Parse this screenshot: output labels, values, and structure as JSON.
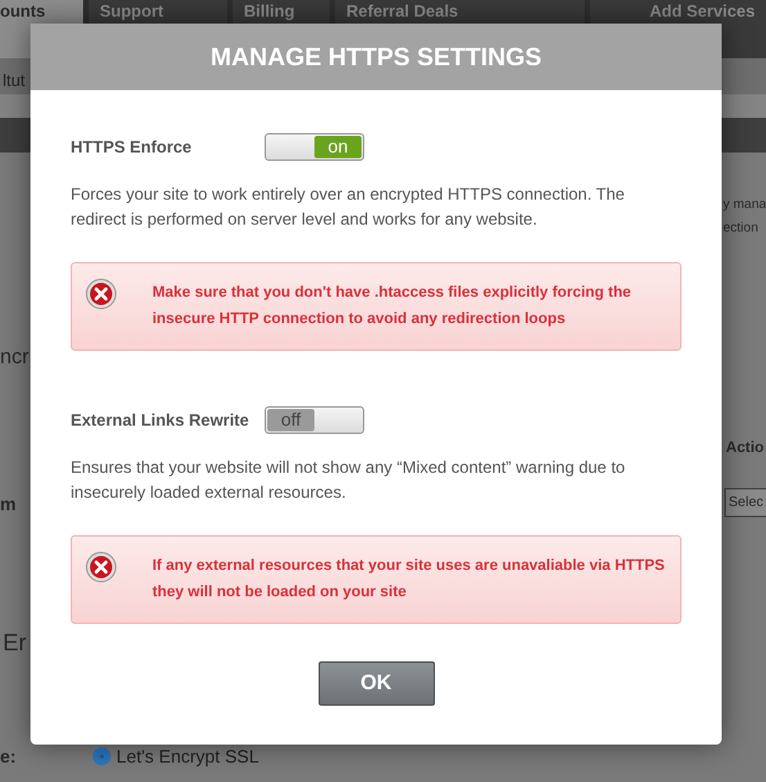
{
  "background": {
    "tabs": [
      {
        "label": "ounts",
        "selected": true
      },
      {
        "label": "Support",
        "selected": false
      },
      {
        "label": "Billing",
        "selected": false
      },
      {
        "label": "Referral Deals",
        "selected": false
      },
      {
        "label": "Add Services",
        "selected": false
      }
    ],
    "breadcrumb": "ltut",
    "description_lines": [
      "y mana",
      "ection"
    ],
    "section_heading": "ncr",
    "table": {
      "header": "Actio",
      "cell": "m",
      "select": "Selec"
    },
    "section_heading_2": "Er",
    "field_label": "e:",
    "radio": {
      "label": "Let's Encrypt SSL",
      "selected": true
    }
  },
  "modal": {
    "title": "MANAGE HTTPS SETTINGS",
    "settings": [
      {
        "label": "HTTPS Enforce",
        "on": true,
        "toggle_text": "on",
        "description": "Forces your site to work entirely over an encrypted HTTPS connection. The redirect is performed on server level and works for any website.",
        "warning": "Make sure that you don't have .htaccess files explicitly forcing the insecure HTTP connection to avoid any redirection loops"
      },
      {
        "label": "External Links Rewrite",
        "on": false,
        "toggle_text": "off",
        "description": "Ensures that your website will not show any “Mixed content” warning due to insecurely loaded external resources.",
        "warning": "If any external resources that your site uses are unavaliable via HTTPS they will not be loaded on your site"
      }
    ],
    "ok_button": "OK"
  }
}
